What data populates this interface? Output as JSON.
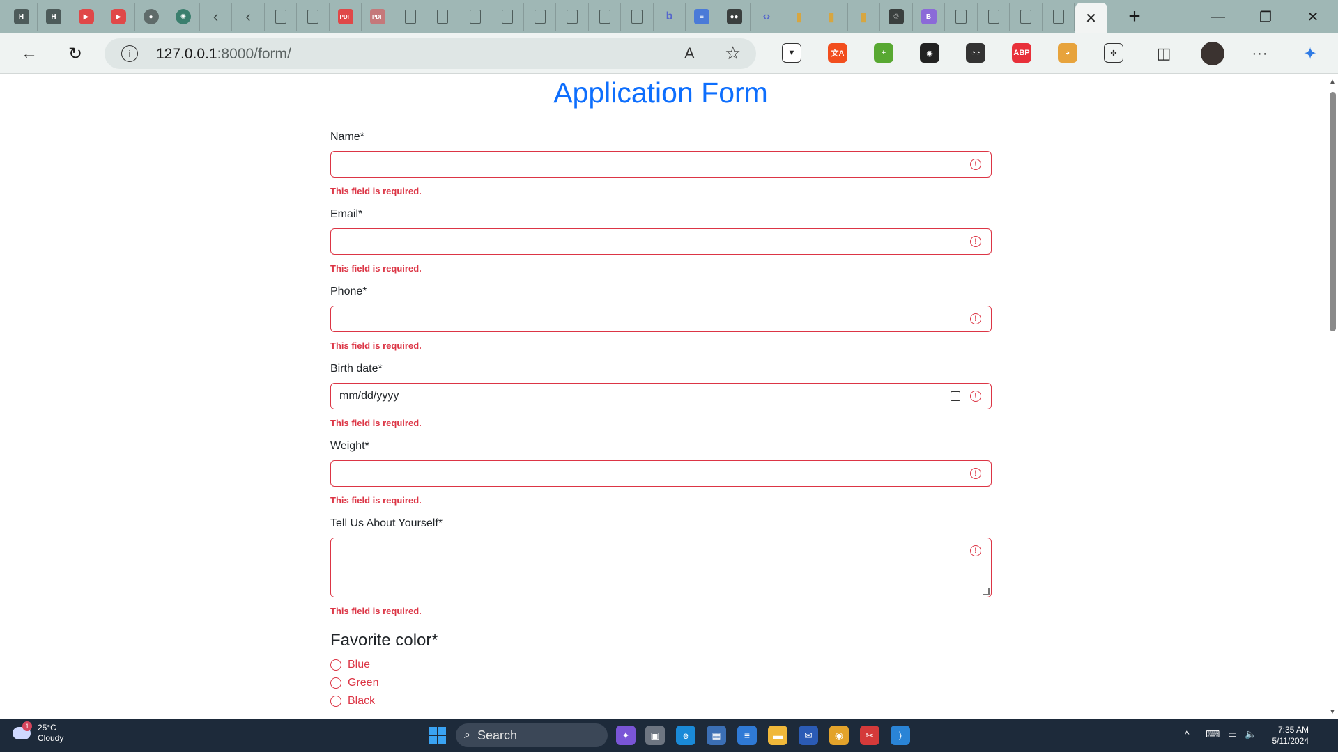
{
  "browser": {
    "tabs": [
      {
        "icon": "habr-icon",
        "glyph": "H"
      },
      {
        "icon": "habr-icon",
        "glyph": "H"
      },
      {
        "icon": "youtube-icon",
        "glyph": "▶"
      },
      {
        "icon": "youtube-icon",
        "glyph": "▶"
      },
      {
        "icon": "github-icon",
        "glyph": "●"
      },
      {
        "icon": "chatgpt-icon",
        "glyph": "✺"
      },
      {
        "icon": "back-arrow-icon",
        "glyph": "‹"
      },
      {
        "icon": "back-arrow-icon",
        "glyph": "‹"
      },
      {
        "icon": "document-icon",
        "glyph": ""
      },
      {
        "icon": "document-icon",
        "glyph": ""
      },
      {
        "icon": "pdf-icon",
        "glyph": "PDF"
      },
      {
        "icon": "pdf-icon",
        "glyph": "PDF"
      },
      {
        "icon": "document-icon",
        "glyph": ""
      },
      {
        "icon": "document-icon",
        "glyph": ""
      },
      {
        "icon": "document-icon",
        "glyph": ""
      },
      {
        "icon": "document-icon",
        "glyph": ""
      },
      {
        "icon": "document-icon",
        "glyph": ""
      },
      {
        "icon": "document-icon",
        "glyph": ""
      },
      {
        "icon": "document-icon",
        "glyph": ""
      },
      {
        "icon": "document-icon",
        "glyph": ""
      },
      {
        "icon": "bing-icon",
        "glyph": "b"
      },
      {
        "icon": "docs-icon",
        "glyph": "≡"
      },
      {
        "icon": "medium-icon",
        "glyph": "●●"
      },
      {
        "icon": "code-icon",
        "glyph": "‹›"
      },
      {
        "icon": "bar-chart-icon",
        "glyph": "▮"
      },
      {
        "icon": "bar-chart-icon",
        "glyph": "▮"
      },
      {
        "icon": "bar-chart-icon",
        "glyph": "▮"
      },
      {
        "icon": "hdpe-icon",
        "glyph": "♲"
      },
      {
        "icon": "letter-b-icon",
        "glyph": "B"
      },
      {
        "icon": "document-icon",
        "glyph": ""
      },
      {
        "icon": "document-icon",
        "glyph": ""
      },
      {
        "icon": "document-icon",
        "glyph": ""
      },
      {
        "icon": "document-icon",
        "glyph": ""
      }
    ],
    "active_tab_close": "✕",
    "new_tab": "+",
    "window_controls": {
      "minimize": "—",
      "restore": "❐",
      "close": "✕"
    },
    "address": {
      "host": "127.0.0.1",
      "rest": ":8000/form/",
      "info_glyph": "i",
      "read_aloud_glyph": "A",
      "favorite_glyph": "☆"
    },
    "nav": {
      "back": "←",
      "refresh": "↻"
    },
    "extensions": [
      {
        "name": "shield-extension-icon",
        "glyph": "▼",
        "color": "#ffffff"
      },
      {
        "name": "translate-extension-icon",
        "glyph": "文A",
        "color": "#f24e1e"
      },
      {
        "name": "plus-extension-icon",
        "glyph": "+",
        "color": "#58a832"
      },
      {
        "name": "color-picker-extension-icon",
        "glyph": "◉",
        "color": "#222222"
      },
      {
        "name": "spy-extension-icon",
        "glyph": "◔◔",
        "color": "#333333"
      },
      {
        "name": "adblock-plus-icon",
        "glyph": "ABP",
        "color": "#e8303a"
      },
      {
        "name": "multi-color-extension-icon",
        "glyph": "◕",
        "color": "#e7a33c"
      },
      {
        "name": "extensions-puzzle-icon",
        "glyph": "✣",
        "color": "#eff3f2"
      }
    ],
    "split_glyph": "◫",
    "more_glyph": "···",
    "copilot_glyph": "✦"
  },
  "form": {
    "title": "Application Form",
    "fields": [
      {
        "label": "Name*",
        "error": "This field is required.",
        "type": "text",
        "placeholder": ""
      },
      {
        "label": "Email*",
        "error": "This field is required.",
        "type": "text",
        "placeholder": ""
      },
      {
        "label": "Phone*",
        "error": "This field is required.",
        "type": "text",
        "placeholder": ""
      },
      {
        "label": "Birth date*",
        "error": "This field is required.",
        "type": "date",
        "placeholder": "mm/dd/yyyy"
      },
      {
        "label": "Weight*",
        "error": "This field is required.",
        "type": "text",
        "placeholder": ""
      },
      {
        "label": "Tell Us About Yourself*",
        "error": "This field is required.",
        "type": "textarea",
        "placeholder": ""
      }
    ],
    "warn_glyph": "!",
    "color_heading": "Favorite color*",
    "color_options": [
      "Blue",
      "Green",
      "Black"
    ],
    "colors": {
      "accent": "#0d6efd",
      "danger": "#dc3545"
    }
  },
  "taskbar": {
    "weather": {
      "temp": "25°C",
      "condition": "Cloudy",
      "badge": "1"
    },
    "search_label": "Search",
    "apps": [
      {
        "name": "copilot-app-icon",
        "glyph": "✦",
        "color": "#7a55d6"
      },
      {
        "name": "task-view-icon",
        "glyph": "▣",
        "color": "#6d7581"
      },
      {
        "name": "edge-app-icon",
        "glyph": "e",
        "color": "#1a8ad8"
      },
      {
        "name": "calculator-app-icon",
        "glyph": "▦",
        "color": "#3b6fb5"
      },
      {
        "name": "notepad-app-icon",
        "glyph": "≡",
        "color": "#2f7ad6"
      },
      {
        "name": "file-explorer-icon",
        "glyph": "▬",
        "color": "#f0b83a"
      },
      {
        "name": "mail-app-icon",
        "glyph": "✉",
        "color": "#2b5bb5"
      },
      {
        "name": "chrome-app-icon",
        "glyph": "◉",
        "color": "#e3a32b"
      },
      {
        "name": "snipping-tool-icon",
        "glyph": "✂",
        "color": "#d43a3a"
      },
      {
        "name": "vscode-app-icon",
        "glyph": "⟩",
        "color": "#2a84d6"
      }
    ],
    "tray": {
      "chevron": "^",
      "keyboard": "⌨",
      "network": "▭",
      "volume": "🔈"
    },
    "time": "7:35 AM",
    "date": "5/11/2024"
  }
}
